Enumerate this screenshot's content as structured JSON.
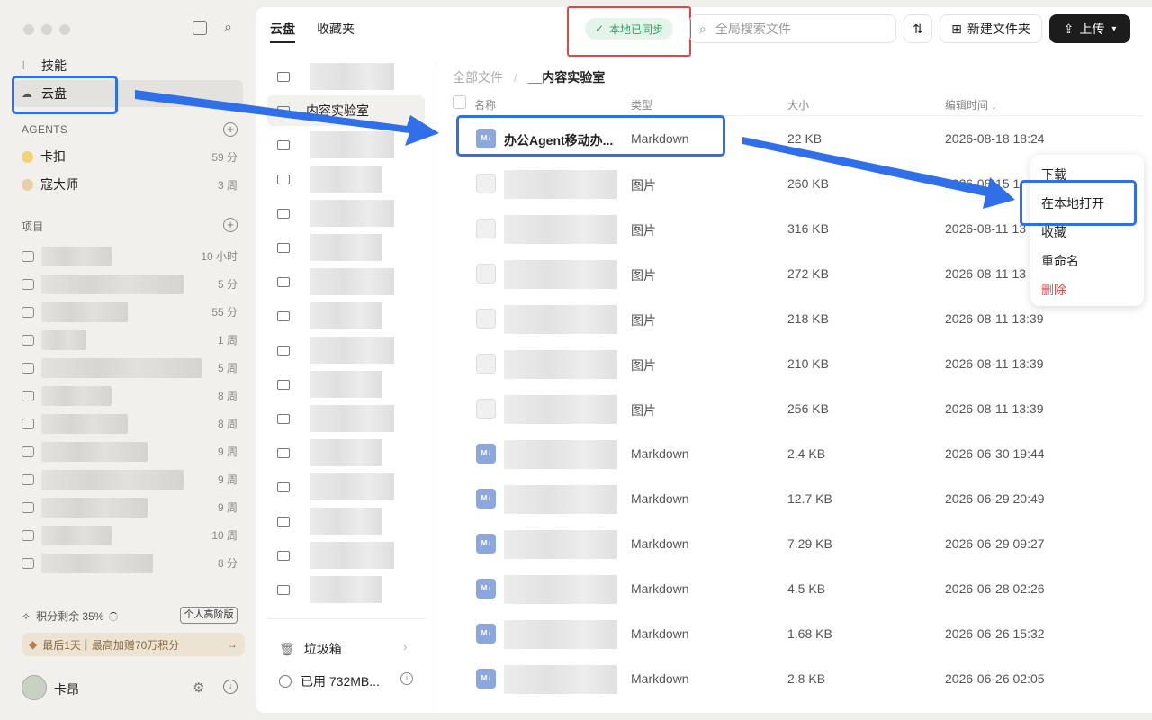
{
  "sidebar": {
    "nav": [
      {
        "label": "技能"
      },
      {
        "label": "云盘"
      }
    ],
    "agents_heading": "AGENTS",
    "agents": [
      {
        "name": "卡扣",
        "time": "59 分"
      },
      {
        "name": "寇大师",
        "time": "3 周"
      }
    ],
    "projects_heading": "项目",
    "project_times": [
      "10 小时",
      "5 分",
      "55 分",
      "1 周",
      "5 周",
      "8 周",
      "8 周",
      "9 周",
      "9 周",
      "9 周",
      "10 周",
      "8 分"
    ],
    "credits_label": "积分剩余 35%",
    "plan_button": "个人高阶版",
    "promo": "最后1天｜最高加赠70万积分",
    "user_name": "卡昂"
  },
  "header": {
    "tabs": [
      "云盘",
      "收藏夹"
    ],
    "sync_badge": "本地已同步",
    "search_placeholder": "全局搜索文件",
    "new_folder": "新建文件夹",
    "upload": "上传"
  },
  "folders": {
    "selected": "内容实验室",
    "trash": "垃圾箱",
    "usage": "已用 732MB..."
  },
  "breadcrumb": {
    "root": "全部文件",
    "sep": "/",
    "current": "__内容实验室"
  },
  "columns": {
    "name": "名称",
    "type": "类型",
    "size": "大小",
    "time": "编辑时间 ↓"
  },
  "files": [
    {
      "name": "办公Agent移动办...",
      "type": "Markdown",
      "size": "22 KB",
      "time": "2026-08-18 18:24",
      "kind": "md"
    },
    {
      "name": "",
      "type": "图片",
      "size": "260 KB",
      "time": "2026-08-15 1",
      "kind": "img"
    },
    {
      "name": "",
      "type": "图片",
      "size": "316 KB",
      "time": "2026-08-11 13",
      "kind": "img"
    },
    {
      "name": "",
      "type": "图片",
      "size": "272 KB",
      "time": "2026-08-11 13",
      "kind": "img"
    },
    {
      "name": "",
      "type": "图片",
      "size": "218 KB",
      "time": "2026-08-11 13:39",
      "kind": "img"
    },
    {
      "name": "",
      "type": "图片",
      "size": "210 KB",
      "time": "2026-08-11 13:39",
      "kind": "img"
    },
    {
      "name": "",
      "type": "图片",
      "size": "256 KB",
      "time": "2026-08-11 13:39",
      "kind": "img"
    },
    {
      "name": "",
      "type": "Markdown",
      "size": "2.4 KB",
      "time": "2026-06-30 19:44",
      "kind": "md"
    },
    {
      "name": "",
      "type": "Markdown",
      "size": "12.7 KB",
      "time": "2026-06-29 20:49",
      "kind": "md"
    },
    {
      "name": "",
      "type": "Markdown",
      "size": "7.29 KB",
      "time": "2026-06-29 09:27",
      "kind": "md"
    },
    {
      "name": "",
      "type": "Markdown",
      "size": "4.5 KB",
      "time": "2026-06-28 02:26",
      "kind": "md"
    },
    {
      "name": "",
      "type": "Markdown",
      "size": "1.68 KB",
      "time": "2026-06-26 15:32",
      "kind": "md"
    },
    {
      "name": "",
      "type": "Markdown",
      "size": "2.8 KB",
      "time": "2026-06-26 02:05",
      "kind": "md"
    }
  ],
  "context_menu": {
    "items": [
      "下载",
      "在本地打开",
      "收藏",
      "重命名",
      "删除"
    ]
  },
  "colors": {
    "accent_blue": "#2f6fe8",
    "danger": "#e04848",
    "sync_green": "#32a060"
  }
}
